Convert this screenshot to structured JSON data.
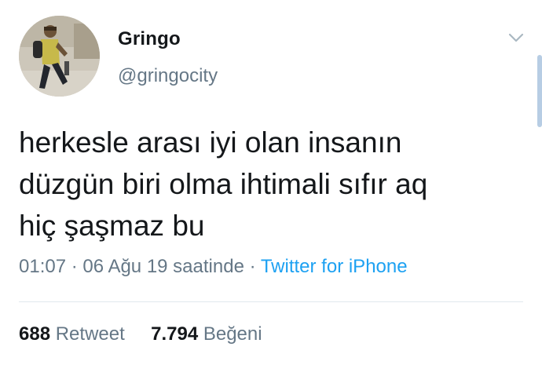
{
  "author": {
    "display_name": "Gringo",
    "handle": "@gringocity",
    "avatar_icon": "profile-photo"
  },
  "menu_icon": "chevron-down-icon",
  "tweet": {
    "lines": [
      "herkesle arası iyi olan insanın",
      "düzgün biri olma ihtimali sıfır aq",
      "hiç şaşmaz bu"
    ]
  },
  "meta": {
    "time": "01:07",
    "separator": "·",
    "date": "06 Ağu 19 saatinde",
    "source": "Twitter for iPhone"
  },
  "stats": {
    "retweets_count": "688",
    "retweets_label": "Retweet",
    "likes_count": "7.794",
    "likes_label": "Beğeni"
  },
  "colors": {
    "text": "#14171a",
    "secondary": "#657786",
    "link": "#1da1f2",
    "divider": "#e1e8ed"
  }
}
